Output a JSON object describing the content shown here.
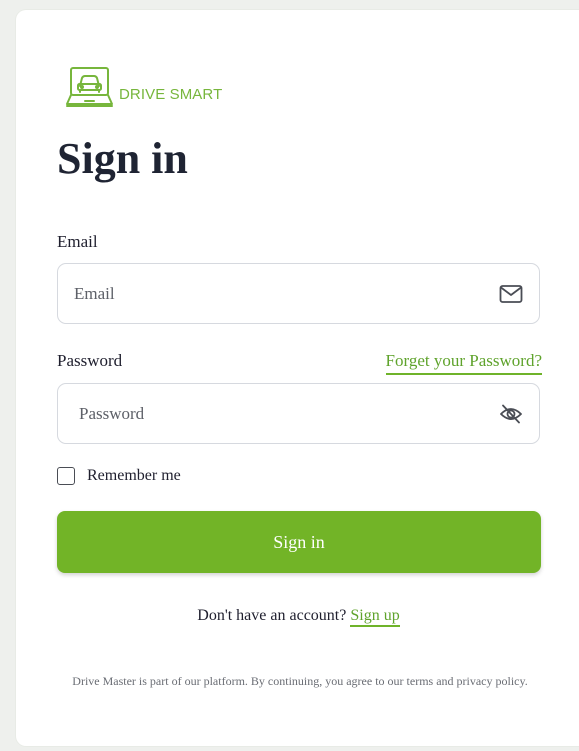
{
  "colors": {
    "accent": "#72b427",
    "link": "#5fa32c",
    "logo": "#77b63c"
  },
  "brand": {
    "name": "DRIVE SMART",
    "icon": "car-screen-logo-icon"
  },
  "heading": "Sign in",
  "email": {
    "label": "Email",
    "placeholder": "Email",
    "value": "",
    "icon": "envelope-icon"
  },
  "password": {
    "label": "Password",
    "placeholder": "Password",
    "value": "",
    "icon": "eye-off-icon",
    "forgot_label": "Forget your Password?"
  },
  "remember": {
    "label": "Remember me",
    "checked": false
  },
  "submit_label": "Sign in",
  "signup": {
    "prompt": "Don't have an account?",
    "link_label": "Sign up"
  },
  "footer_note": "Drive Master is part of our platform. By continuing, you agree to our terms and privacy policy."
}
